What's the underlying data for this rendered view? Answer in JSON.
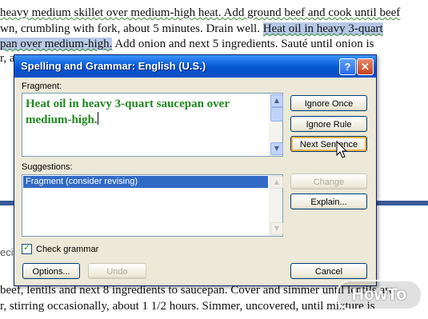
{
  "document": {
    "lines": [
      "heavy medium  skillet  over medium-high  heat. Add ground beef and cook until beef",
      "wn, crumbling with fork, about 5 minutes. Drain well.",
      "pan over medium-high.",
      "r, a",
      "beef, lentils and next 8 ingredients to saucepan. Cover and simmer until lentils are",
      "r, stirring occasionally,  about 1 1/2 hours. Simmer, uncovered, until mixture is",
      "ecip"
    ],
    "line2_highlight": "Heat oil in heavy 3-quart",
    "line3_rest": " Add onion and next 5 ingredients. Sauté until onion is"
  },
  "dialog": {
    "title": "Spelling and Grammar: English (U.S.)",
    "help_glyph": "?",
    "close_glyph": "✕",
    "fragment_label": "Fragment:",
    "fragment_text": "Heat oil in heavy 3-quart saucepan over medium-high.",
    "suggestions_label": "Suggestions:",
    "suggestions": [
      "Fragment (consider revising)"
    ],
    "check_grammar_label": "Check grammar",
    "check_grammar_checked": true,
    "buttons": {
      "ignore_once": "Ignore Once",
      "ignore_rule": "Ignore Rule",
      "next_sentence": "Next Sentence",
      "change": "Change",
      "explain": "Explain...",
      "options": "Options...",
      "undo": "Undo",
      "cancel": "Cancel"
    }
  },
  "watermark": "HowTo",
  "colors": {
    "titlebar": "#0553d0",
    "fragment_text": "#1f8a1f",
    "selection": "#316ac5"
  }
}
